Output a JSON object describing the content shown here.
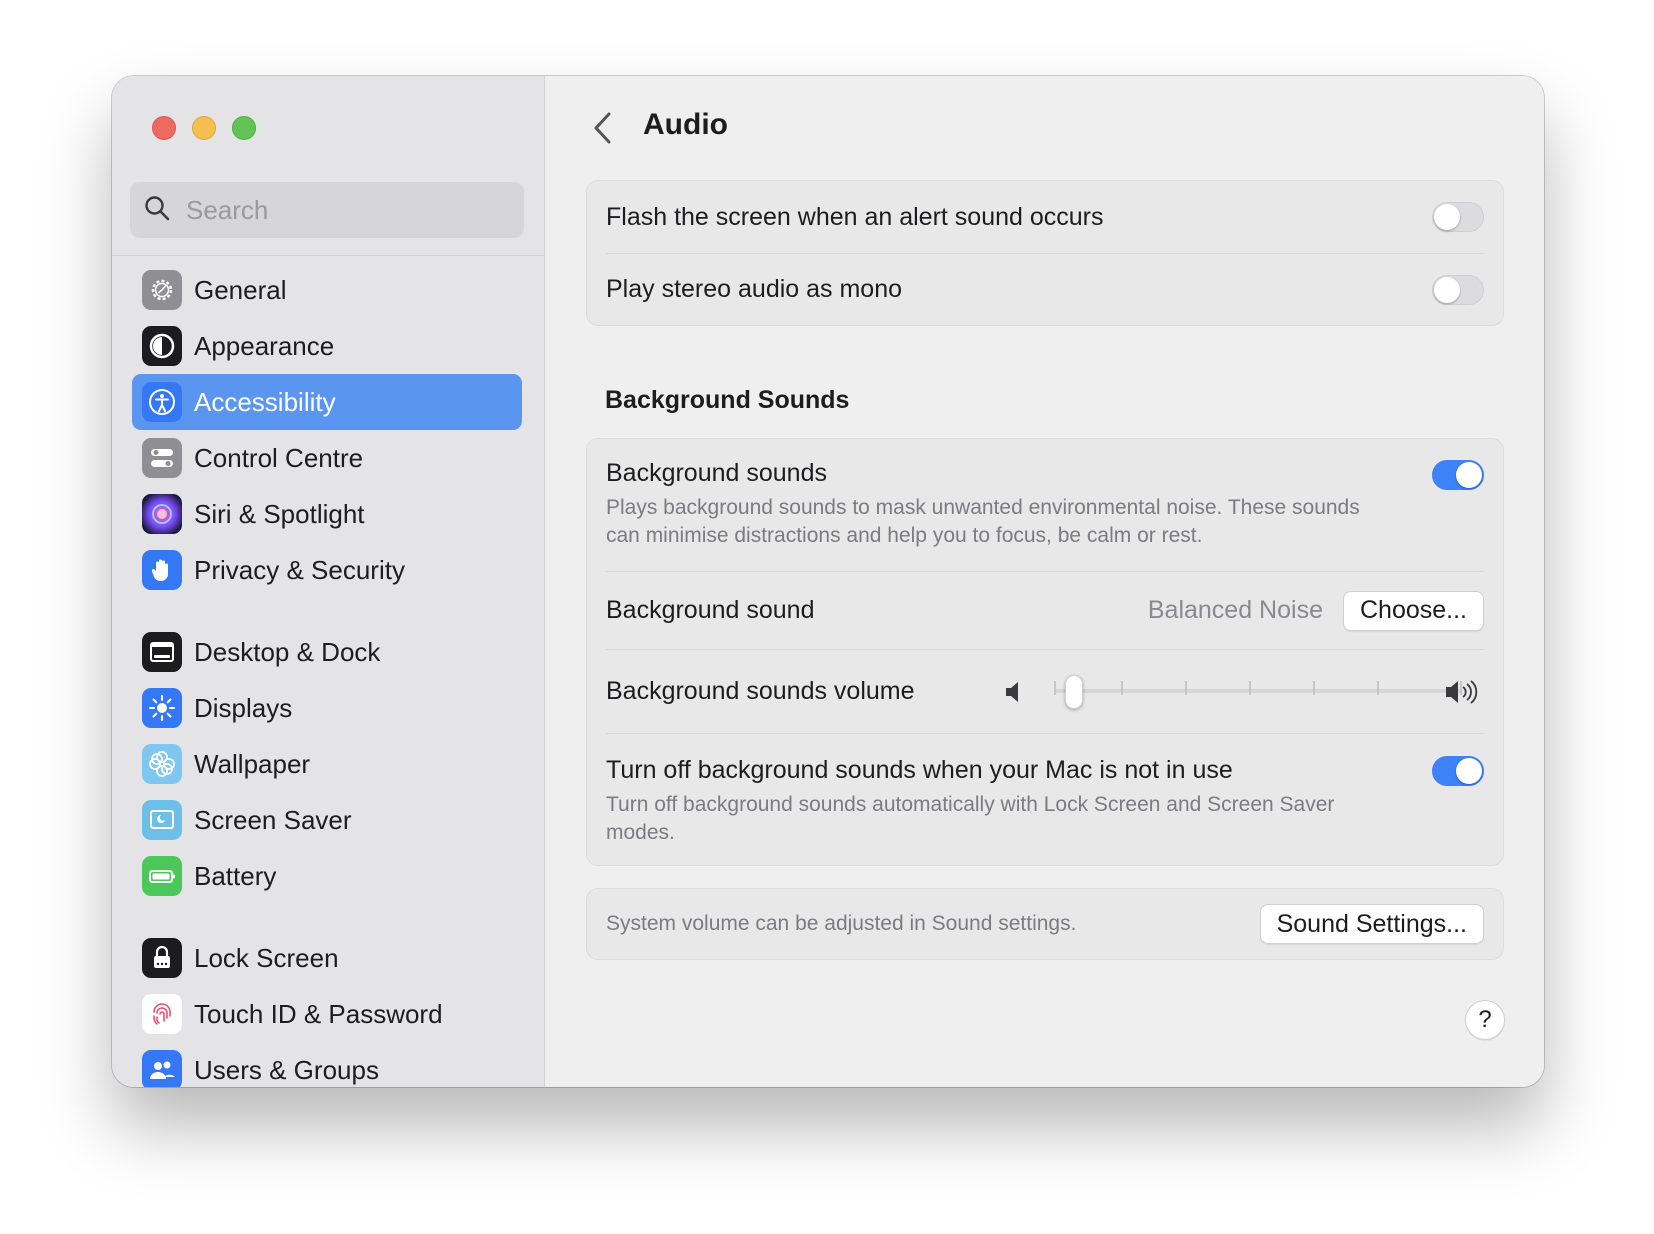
{
  "sidebar": {
    "search_placeholder": "Search",
    "items": [
      {
        "label": "General",
        "icon": "gear-icon"
      },
      {
        "label": "Appearance",
        "icon": "appearance-icon"
      },
      {
        "label": "Accessibility",
        "icon": "accessibility-icon",
        "active": true
      },
      {
        "label": "Control Centre",
        "icon": "control-centre-icon"
      },
      {
        "label": "Siri & Spotlight",
        "icon": "siri-icon"
      },
      {
        "label": "Privacy & Security",
        "icon": "hand-icon"
      },
      {
        "label": "Desktop & Dock",
        "icon": "dock-icon"
      },
      {
        "label": "Displays",
        "icon": "sun-icon"
      },
      {
        "label": "Wallpaper",
        "icon": "flower-icon"
      },
      {
        "label": "Screen Saver",
        "icon": "screen-saver-icon"
      },
      {
        "label": "Battery",
        "icon": "battery-icon"
      },
      {
        "label": "Lock Screen",
        "icon": "lock-icon"
      },
      {
        "label": "Touch ID & Password",
        "icon": "fingerprint-icon"
      },
      {
        "label": "Users & Groups",
        "icon": "users-icon"
      }
    ]
  },
  "main": {
    "title": "Audio",
    "alerts": {
      "flash_label": "Flash the screen when an alert sound occurs",
      "flash_on": false,
      "mono_label": "Play stereo audio as mono",
      "mono_on": false
    },
    "background": {
      "heading": "Background Sounds",
      "toggle_label": "Background sounds",
      "toggle_desc": "Plays background sounds to mask unwanted environmental noise. These sounds can minimise distractions and help you to focus, be calm or rest.",
      "toggle_on": true,
      "sound_label": "Background sound",
      "sound_value": "Balanced Noise",
      "choose_button": "Choose...",
      "volume_label": "Background sounds volume",
      "volume_level": 0.05,
      "autooff_label": "Turn off background sounds when your Mac is not in use",
      "autooff_desc": "Turn off background sounds automatically with Lock Screen and Screen Saver modes.",
      "autooff_on": true
    },
    "footer": {
      "note": "System volume can be adjusted in Sound settings.",
      "sound_settings_button": "Sound Settings..."
    },
    "help_label": "?"
  },
  "colors": {
    "accent": "#3d82f6",
    "sidebar_selection": "#5a96f0"
  }
}
